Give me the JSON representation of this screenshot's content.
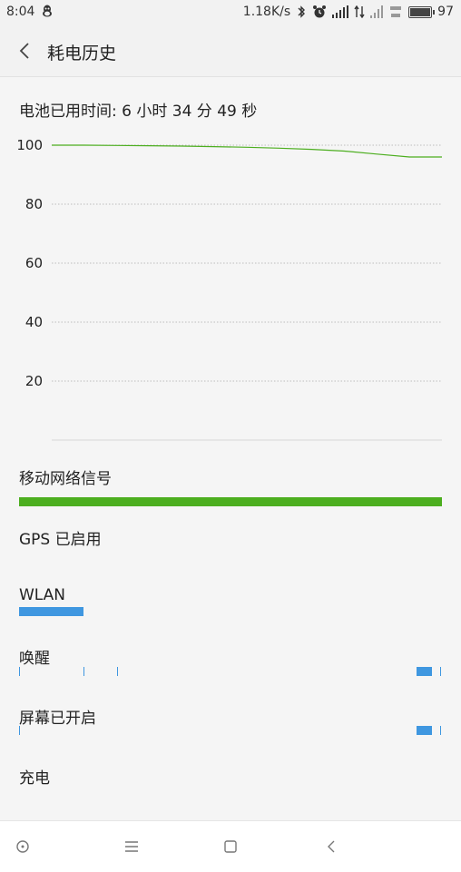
{
  "status_bar": {
    "time": "8:04",
    "speed": "1.18K/s",
    "battery_level": "97",
    "battery_fraction": 0.97
  },
  "header": {
    "title": "耗电历史"
  },
  "usage": {
    "text": "电池已用时间: 6 小时 34 分 49 秒"
  },
  "chart_data": {
    "type": "line",
    "y_ticks": [
      "100",
      "80",
      "60",
      "40",
      "20"
    ],
    "ylim": [
      0,
      100
    ],
    "grid": true,
    "series": [
      {
        "values": [
          100,
          100,
          99.9,
          99.8,
          99.7,
          99.5,
          99.3,
          99,
          98.6,
          98,
          97,
          96,
          96
        ]
      }
    ],
    "color": "#4cae1f"
  },
  "sections": {
    "mobile_signal": "移动网络信号",
    "gps": "GPS 已启用",
    "wlan": "WLAN",
    "wake": "唤醒",
    "screen_on": "屏幕已开启",
    "charging": "充电"
  },
  "colors": {
    "green": "#4cae1f",
    "blue": "#3f97e0",
    "background": "#f5f5f5"
  },
  "nav_icons": [
    "circle-icon",
    "menu-icon",
    "square-icon",
    "back-icon"
  ]
}
